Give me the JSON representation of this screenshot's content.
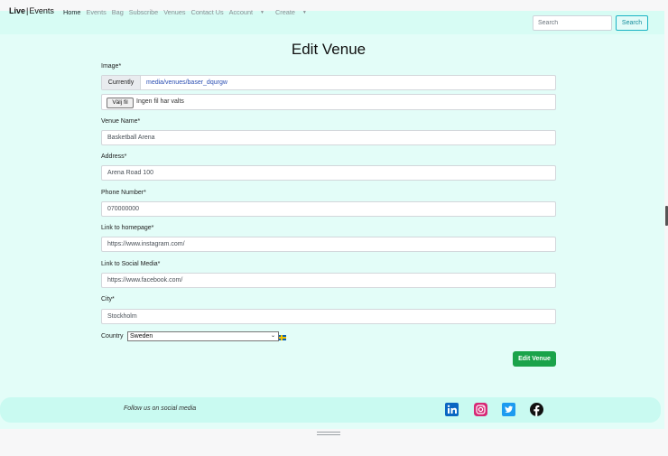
{
  "navbar": {
    "brand_left": "Live",
    "brand_sep": "|",
    "brand_right": "Events",
    "links": [
      "Home",
      "Events",
      "Bag",
      "Subscribe",
      "Venues",
      "Contact Us",
      "Account",
      "Create"
    ],
    "search_placeholder": "Search",
    "search_button": "Search"
  },
  "form": {
    "title": "Edit Venue",
    "image_label": "Image*",
    "currently_label": "Currently",
    "current_file": "media/venues/baser_dqurgw",
    "file_button": "Välj fil",
    "file_status": "Ingen fil har valts",
    "venue_name_label": "Venue Name*",
    "venue_name": "Basketball Arena",
    "address_label": "Address*",
    "address": "Arena Road 100",
    "phone_label": "Phone Number*",
    "phone": "070000000",
    "homepage_label": "Link to homepage*",
    "homepage": "https://www.instagram.com/",
    "social_label": "Link to Social Media*",
    "social": "https://www.facebook.com/",
    "city_label": "City*",
    "city": "Stockholm",
    "country_label": "Country",
    "country": "Sweden",
    "submit": "Edit Venue"
  },
  "footer": {
    "text": "Follow us on social media",
    "icons": [
      "linkedin-icon",
      "instagram-icon",
      "twitter-icon",
      "facebook-icon"
    ]
  },
  "colors": {
    "page_bg": "#e3fdf8",
    "navbar_bg": "#d7fcf4",
    "footer_bg": "#c9faf1",
    "submit_green": "#1aa34a",
    "search_teal": "#1ab3c4"
  }
}
